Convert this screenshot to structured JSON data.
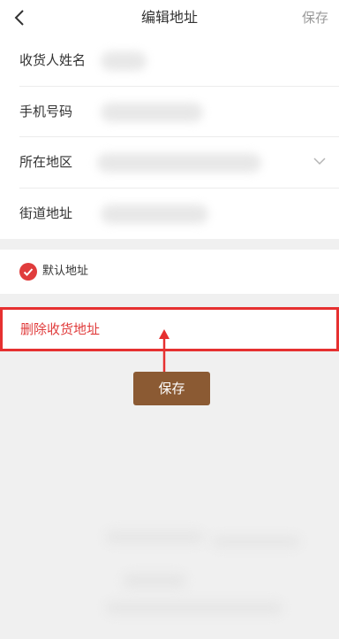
{
  "nav": {
    "back_icon": "chevron-left-icon",
    "title": "编辑地址",
    "save": "保存"
  },
  "form": {
    "fields": [
      {
        "label": "收货人姓名"
      },
      {
        "label": "手机号码"
      },
      {
        "label": "所在地区",
        "icon": "chevron-down-icon"
      },
      {
        "label": "街道地址"
      }
    ]
  },
  "default_address": {
    "label": "默认地址",
    "checked": true,
    "icon": "check-circle-icon",
    "color": "#e03c3c"
  },
  "delete": {
    "label": "删除收货地址",
    "color": "#e03c3c"
  },
  "annotation": {
    "tooltip": "保存",
    "highlight_color": "#e63030",
    "tooltip_color": "#8b5a33"
  }
}
